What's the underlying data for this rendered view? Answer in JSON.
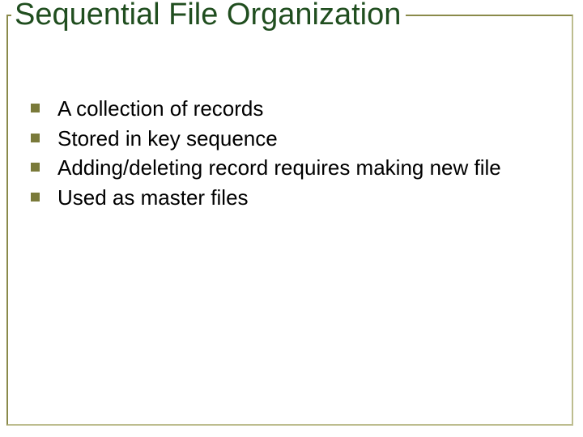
{
  "title": "Sequential File Organization",
  "bullets": [
    "A collection of records",
    "Stored in key sequence",
    "Adding/deleting record requires making new file",
    "Used as master files"
  ]
}
